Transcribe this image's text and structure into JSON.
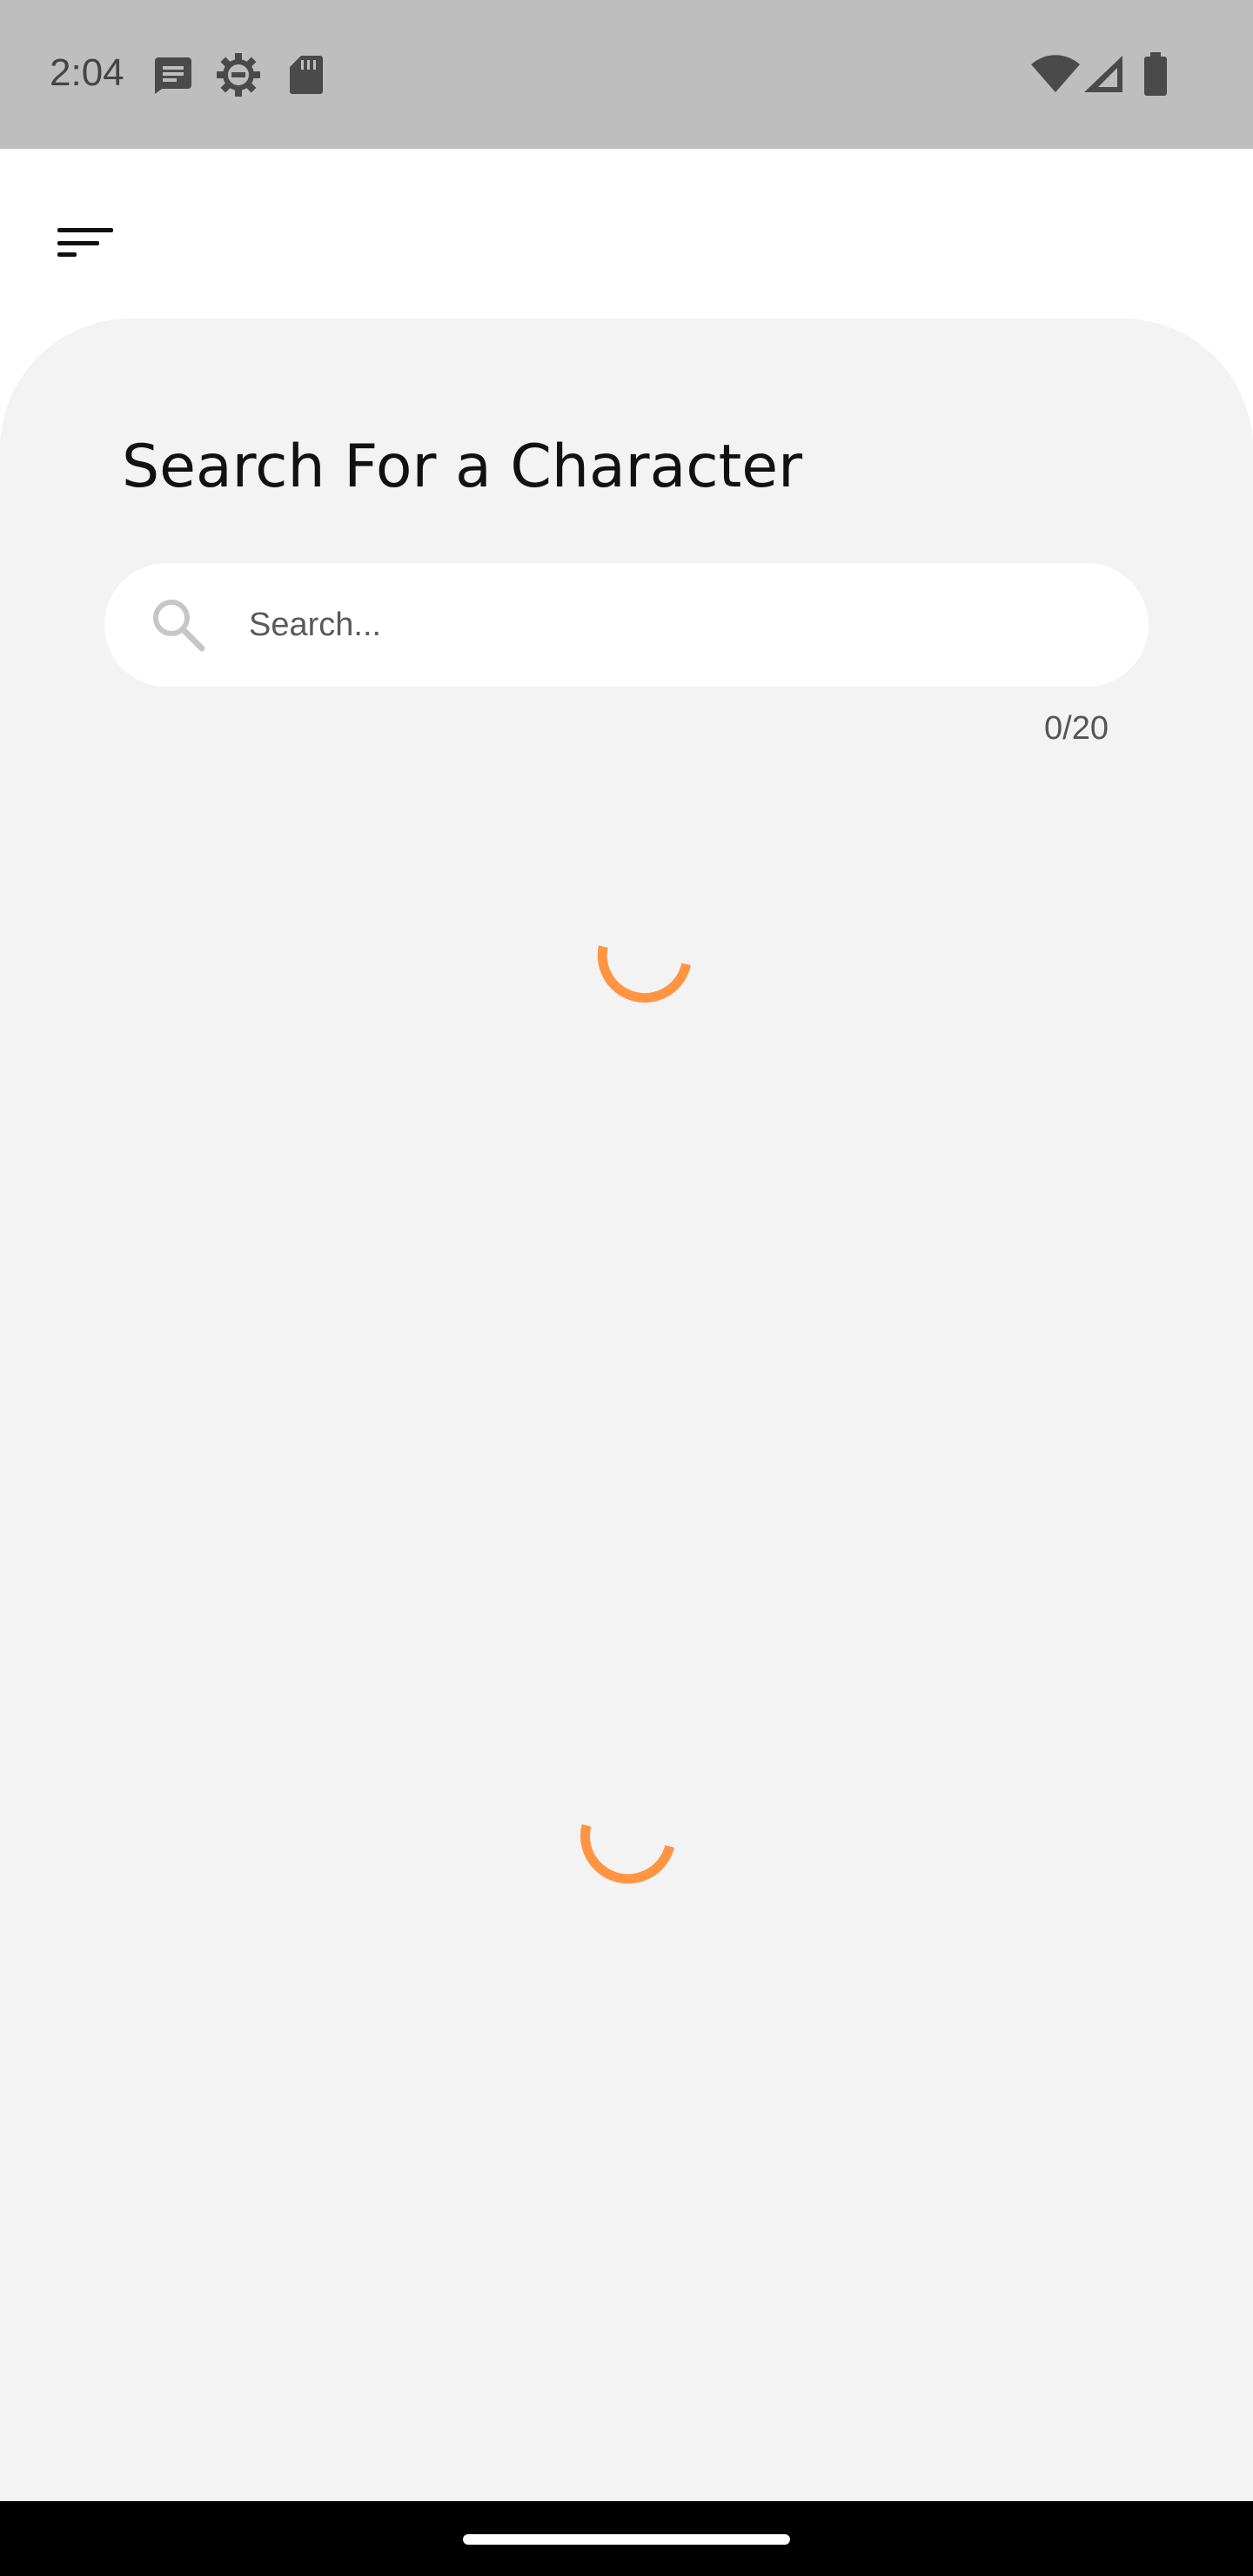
{
  "status_bar": {
    "time": "2:04",
    "notification_icons": [
      "message-icon",
      "settings-gear-icon",
      "sd-card-icon"
    ],
    "system_icons": [
      "wifi-icon",
      "cellular-signal-icon",
      "battery-icon"
    ]
  },
  "header": {
    "menu_icon": "sort-menu-icon"
  },
  "main": {
    "title": "Search For a Character",
    "search": {
      "placeholder": "Search...",
      "value": "",
      "icon": "search-icon"
    },
    "counter": "0/20",
    "loading_indicators": 2
  },
  "colors": {
    "status_bar_bg": "#bebebe",
    "panel_bg": "#f3f3f3",
    "accent_spinner": "#ff9543",
    "nav_bar_bg": "#000000"
  }
}
